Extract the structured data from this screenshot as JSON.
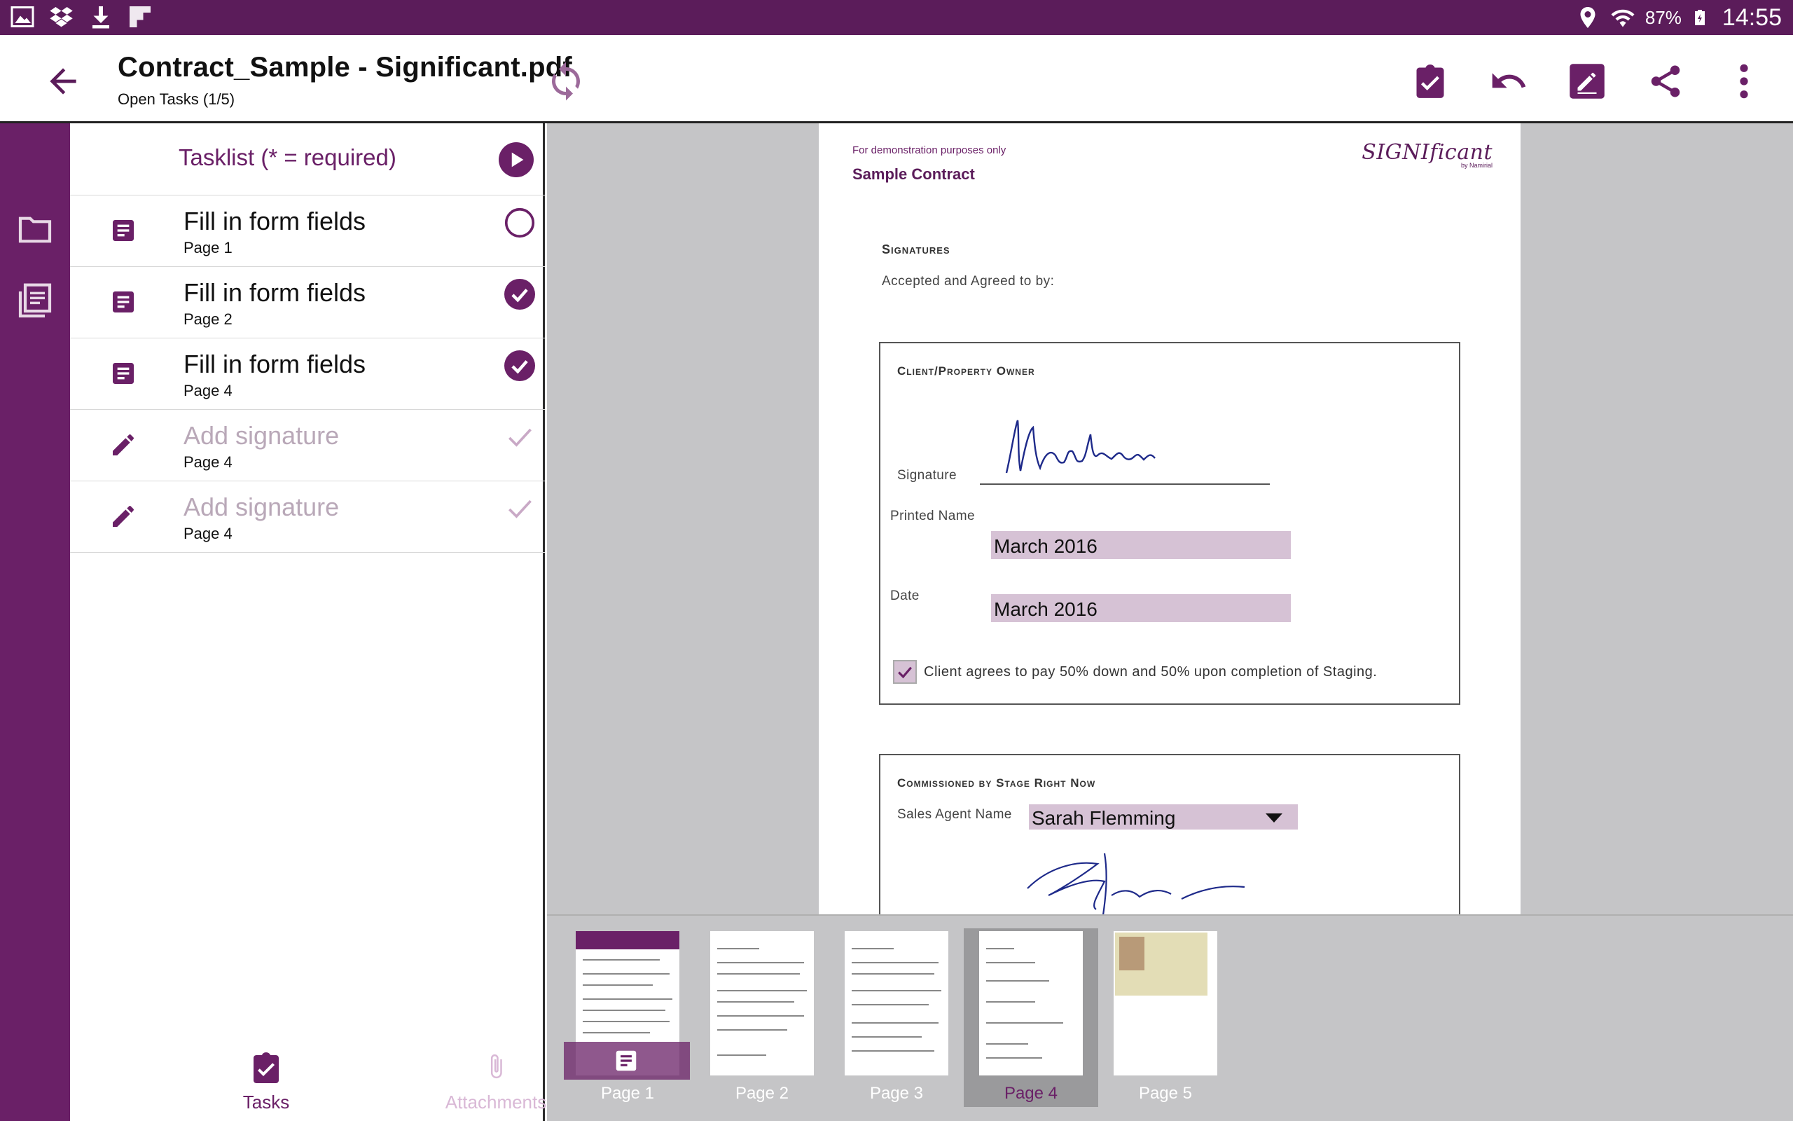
{
  "status_bar": {
    "battery": "87%",
    "time": "14:55",
    "left_icons": [
      "gallery-icon",
      "dropbox-icon",
      "download-icon",
      "flipboard-icon"
    ],
    "right_icons": [
      "location-icon",
      "wifi-icon",
      "battery-icon"
    ]
  },
  "app_bar": {
    "title": "Contract_Sample - Significant.pdf",
    "subtitle": "Open Tasks (1/5)",
    "actions": [
      "task-check-icon",
      "undo-icon",
      "edit-icon",
      "share-icon",
      "more-icon"
    ]
  },
  "tasklist": {
    "header": "Tasklist (* = required)",
    "items": [
      {
        "label": "Fill in form fields",
        "page": "Page 1",
        "status": "open",
        "type": "form",
        "enabled": true
      },
      {
        "label": "Fill in form fields",
        "page": "Page 2",
        "status": "done",
        "type": "form",
        "enabled": true
      },
      {
        "label": "Fill in form fields",
        "page": "Page 4",
        "status": "done",
        "type": "form",
        "enabled": true
      },
      {
        "label": "Add signature",
        "page": "Page 4",
        "status": "pending",
        "type": "signature",
        "enabled": false
      },
      {
        "label": "Add signature",
        "page": "Page 4",
        "status": "pending",
        "type": "signature",
        "enabled": false
      }
    ]
  },
  "bottom_tabs": {
    "tasks": "Tasks",
    "attachments": "Attachments"
  },
  "document": {
    "demo_note": "For demonstration purposes only",
    "title": "Sample Contract",
    "logo_text": "SIGNIficant",
    "logo_sub": "by Namirial",
    "signatures_heading": "Signatures",
    "accepted": "Accepted and Agreed to by:",
    "client_box": {
      "heading": "Client/Property Owner",
      "signature_label": "Signature",
      "signature_text": "Mustermann",
      "printed_name_label": "Printed Name",
      "printed_name_value": "March 2016",
      "date_label": "Date",
      "date_value": "March 2016",
      "checkbox_checked": true,
      "checkbox_text": "Client agrees to pay 50% down and 50% upon completion of Staging."
    },
    "commission_box": {
      "heading": "Commissioned by Stage Right Now",
      "agent_label": "Sales Agent Name",
      "agent_value": "Sarah Flemming"
    }
  },
  "thumbnails": {
    "pages": [
      "Page 1",
      "Page 2",
      "Page 3",
      "Page 4",
      "Page 5"
    ],
    "selected": "Page 4"
  },
  "colors": {
    "brand": "#6a2067",
    "status_bar": "#5b1c5a",
    "field_fill": "#d6c2d5"
  }
}
